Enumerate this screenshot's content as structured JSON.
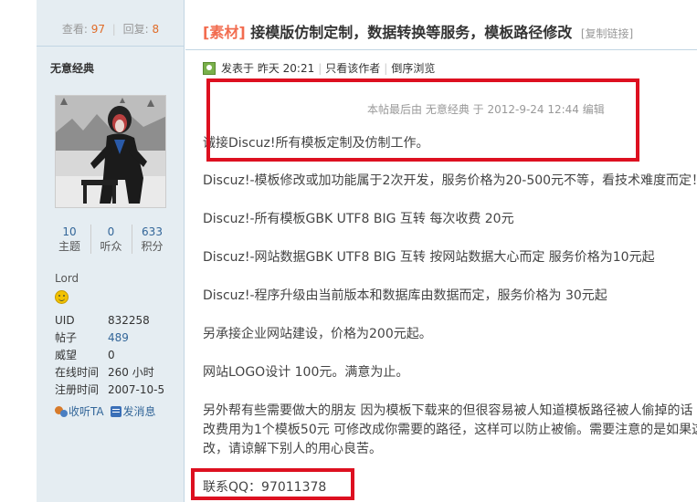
{
  "sidebar": {
    "views_label": "查看:",
    "views": "97",
    "replies_label": "回复:",
    "replies": "8",
    "author": "无意经典",
    "counters": [
      {
        "value": "10",
        "label": "主题"
      },
      {
        "value": "0",
        "label": "听众"
      },
      {
        "value": "633",
        "label": "积分"
      }
    ],
    "rank": "Lord",
    "info": [
      {
        "key": "UID",
        "value": "832258"
      },
      {
        "key": "帖子",
        "value": "489"
      },
      {
        "key": "威望",
        "value": "0"
      },
      {
        "key": "在线时间",
        "value": "260 小时"
      },
      {
        "key": "注册时间",
        "value": "2007-10-5"
      }
    ],
    "follow_label": "收听TA",
    "message_label": "发消息"
  },
  "thread": {
    "tag": "[素材]",
    "title": "接模版仿制定制，数据转换等服务，模板路径修改",
    "copy_link": "[复制链接]"
  },
  "meta": {
    "posted": "发表于  昨天 20:21",
    "only_author": "只看该作者",
    "reverse": "倒序浏览"
  },
  "edit_note": "本帖最后由  无意经典  于  2012-9-24 12:44  编辑",
  "post": {
    "lines": [
      "诚接Discuz!所有模板定制及仿制工作。",
      "Discuz!-模板修改或加功能属于2次开发，服务价格为20-500元不等，看技术难度而定！",
      "Discuz!-所有模板GBK UTF8 BIG 互转  每次收费  20元",
      "Discuz!-网站数据GBK UTF8 BIG 互转  按网站数据大心而定  服务价格为10元起",
      "Discuz!-程序升级由当前版本和数据库由数据而定，服务价格为  30元起",
      "另承接企业网站建设，价格为200元起。",
      "网站LOGO设计  100元。满意为止。",
      "另外帮有些需要做大的朋友  因为模板下载来的但很容易被人知道模板路径被人偷掉的话",
      "改费用为1个模板50元  可修改成你需要的路径，这样可以防止被偷。需要注意的是如果这",
      "改，请谅解下别人的用心良苦。",
      "联系QQ：97011378"
    ]
  },
  "colors": {
    "sidebar_bg": "#e5edf2",
    "link": "#336699",
    "tag": "#f26c4f",
    "count": "#e06c29",
    "highlight_box": "#dd1020"
  }
}
